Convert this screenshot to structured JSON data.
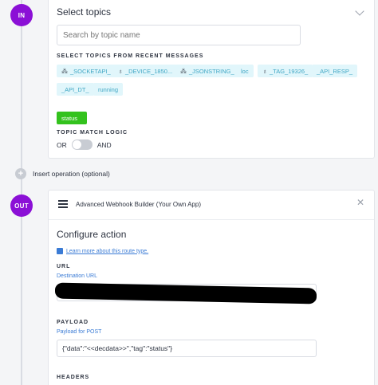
{
  "in_badge": "IN",
  "out_badge": "OUT",
  "topics": {
    "title": "Select topics",
    "search_placeholder": "Search by topic name",
    "recent_heading": "SELECT TOPICS FROM RECENT MESSAGES",
    "recent_chips": [
      {
        "label": "_SOCKETAPI_",
        "icon": "cluster-icon"
      },
      {
        "label": "_DEVICE_1850...",
        "icon": "device-icon"
      },
      {
        "label": "_JSONSTRING_",
        "icon": "cluster-icon"
      },
      {
        "label": "loc",
        "icon": ""
      },
      {
        "label": "_TAG_19326_",
        "icon": "device-icon"
      },
      {
        "label": "_API_RESP_",
        "icon": ""
      },
      {
        "label": "_API_DT_",
        "icon": ""
      },
      {
        "label": "running",
        "icon": ""
      }
    ],
    "selected_chip": "status",
    "match_logic_heading": "TOPIC MATCH LOGIC",
    "or_label": "OR",
    "and_label": "AND",
    "match_logic_and": false
  },
  "insert_operation": "Insert operation (optional)",
  "action": {
    "builder_title": "Advanced Webhook Builder (Your Own App)",
    "configure_title": "Configure action",
    "learn_more": "Learn more about this route type.",
    "url_heading": "URL",
    "url_sub": "Destination URL",
    "payload_heading": "PAYLOAD",
    "payload_sub": "Payload for POST",
    "payload_value": "{\"data\":\"<<decdata>>\",\"tag\":\"status\"}",
    "headers_heading": "HEADERS"
  },
  "colors": {
    "badge": "#8b10d6",
    "chip_bg": "#e1f6fb",
    "chip_text": "#3fa6c4",
    "selected_chip": "#33c21d",
    "link": "#3a7bd5"
  }
}
